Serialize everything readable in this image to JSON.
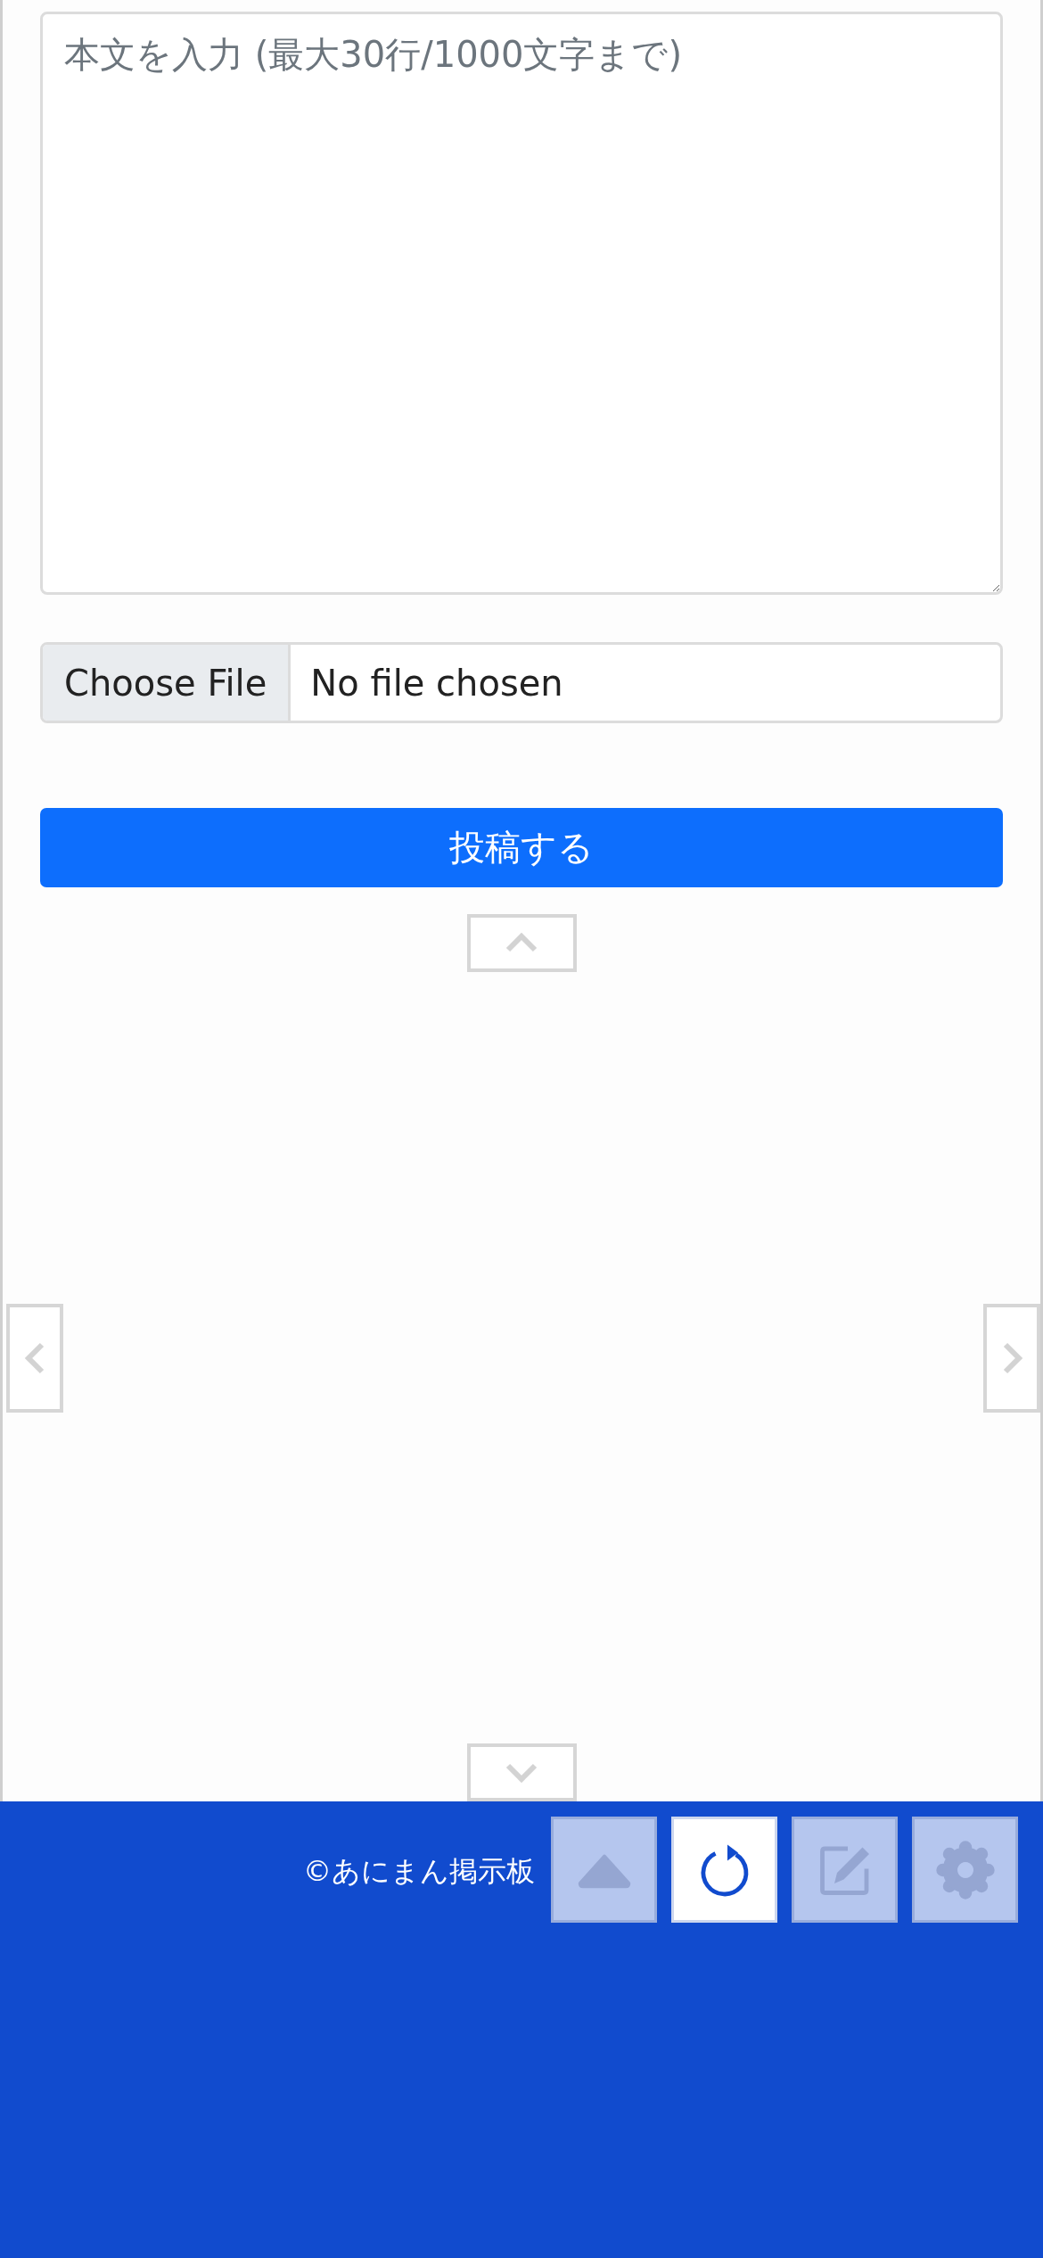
{
  "form": {
    "body": {
      "placeholder": "本文を入力 (最大30行/1000文字まで)"
    },
    "file": {
      "button": "Choose File",
      "status": "No file chosen"
    },
    "submit": "投稿する"
  },
  "footer": {
    "copyright": "©あにまん掲示板"
  },
  "toolbar": [
    {
      "kind": "top",
      "disabled": true
    },
    {
      "kind": "reload",
      "disabled": false
    },
    {
      "kind": "post",
      "disabled": true
    },
    {
      "kind": "settings",
      "disabled": true
    }
  ]
}
